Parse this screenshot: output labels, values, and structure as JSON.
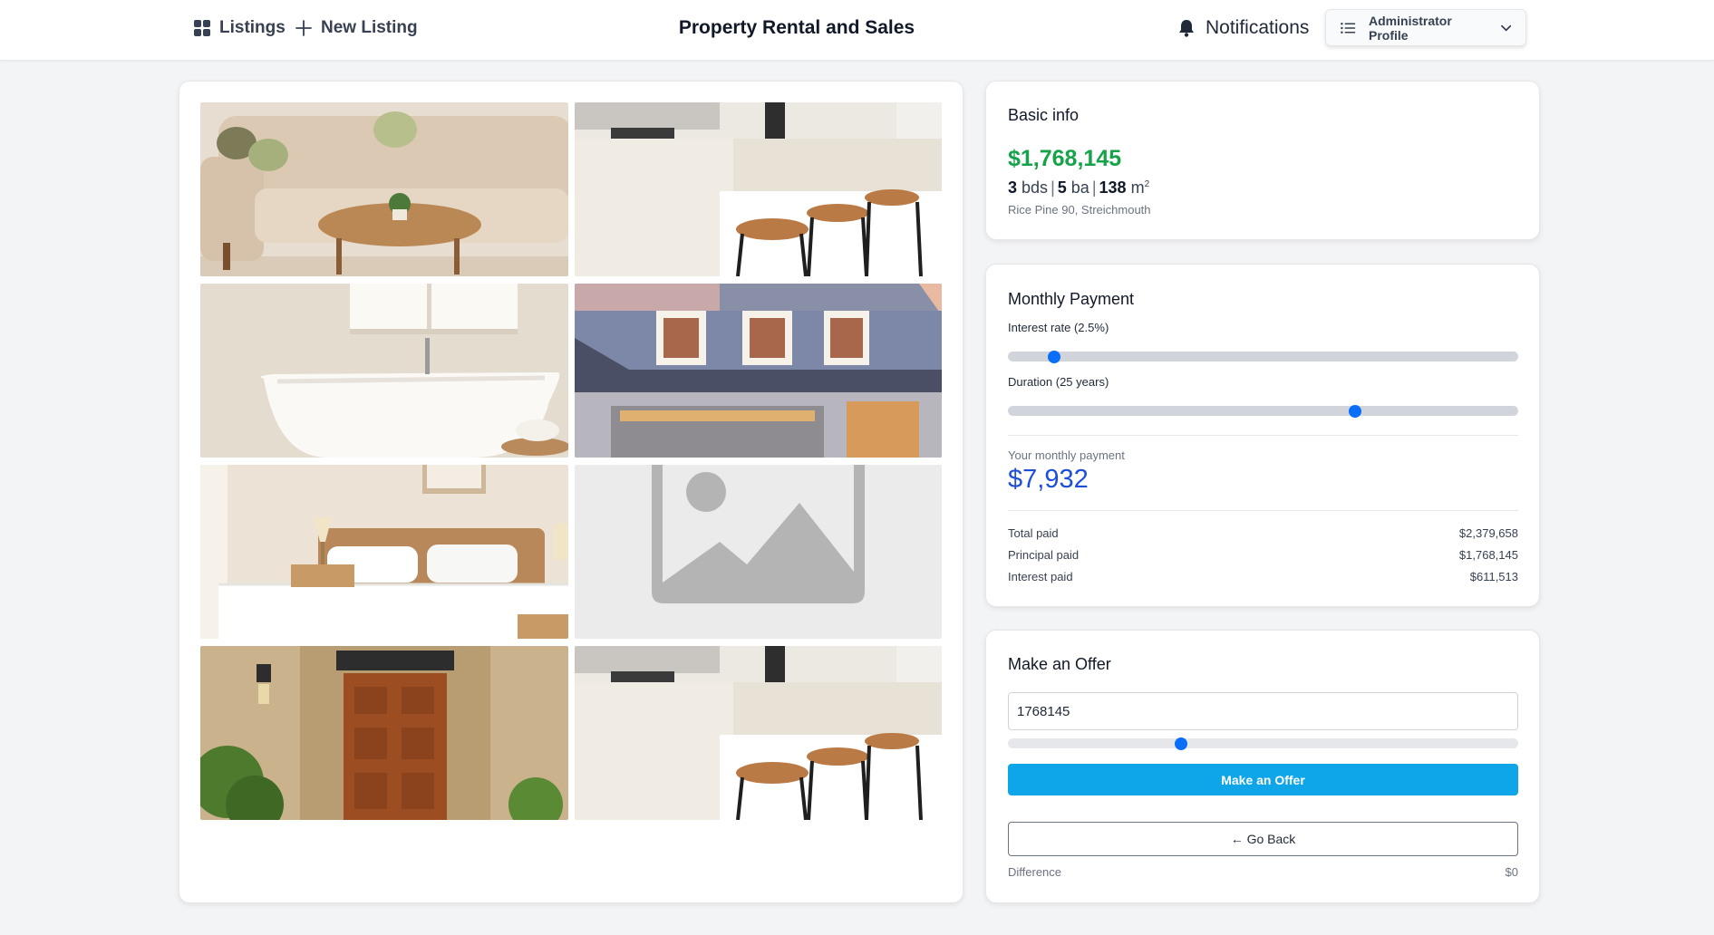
{
  "header": {
    "nav": {
      "listings": "Listings",
      "new_listing": "New Listing"
    },
    "title": "Property Rental and Sales",
    "notifications": "Notifications",
    "profile": "Administrator Profile",
    "icons": {
      "listings": "grid-icon",
      "new_listing": "plus-icon",
      "notifications": "bell-icon",
      "profile": "list-icon",
      "profile_toggle": "chevron-down-icon"
    }
  },
  "gallery": {
    "photos": [
      "living-room",
      "kitchen-counter",
      "bathroom-tub",
      "house-exterior",
      "bedroom",
      "placeholder-image",
      "front-door",
      "kitchen-counter"
    ]
  },
  "basic_info": {
    "title": "Basic info",
    "price": "$1,768,145",
    "beds": "3",
    "beds_unit": "bds",
    "baths": "5",
    "baths_unit": "ba",
    "area": "138",
    "area_unit": "m",
    "area_sup": "2",
    "address": "Rice Pine 90, Streichmouth"
  },
  "monthly_payment": {
    "title": "Monthly Payment",
    "interest_label": "Interest rate (2.5%)",
    "interest_fraction": 0.09,
    "duration_label": "Duration (25 years)",
    "duration_fraction": 0.68,
    "your_payment_label": "Your monthly payment",
    "monthly_value": "$7,932",
    "rows": [
      {
        "label": "Total paid",
        "value": "$2,379,658"
      },
      {
        "label": "Principal paid",
        "value": "$1,768,145"
      },
      {
        "label": "Interest paid",
        "value": "$611,513"
      }
    ]
  },
  "offer": {
    "title": "Make an Offer",
    "input_value": "1768145",
    "slider_fraction": 0.34,
    "submit_label": "Make an Offer",
    "back_label": "← Go Back",
    "difference_label": "Difference",
    "difference_value": "$0"
  },
  "colors": {
    "price_green": "#16a34a",
    "payment_blue": "#1d4ed8",
    "slider_thumb": "#0b6ef8",
    "offer_button": "#0ea5e9"
  }
}
